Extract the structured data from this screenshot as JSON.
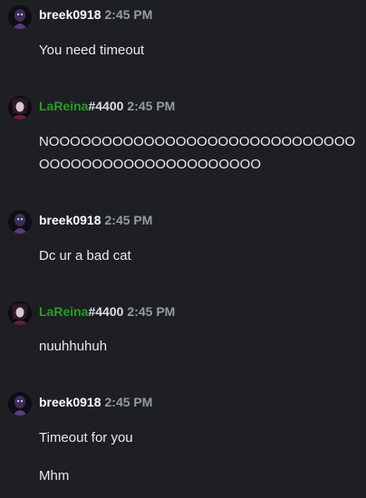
{
  "messages": [
    {
      "user": "breek0918",
      "discriminator": "",
      "user_color": "#ffffff",
      "timestamp": "2:45 PM",
      "lines": [
        "You need timeout"
      ]
    },
    {
      "user": "LaReina",
      "discriminator": "#4400",
      "user_color": "#2c9a2a",
      "timestamp": "2:45 PM",
      "lines": [
        "NOOOOOOOOOOOOOOOOOOOOOOOOOOOOOOOOOOOOOOOOOOOOOOOOOO"
      ]
    },
    {
      "user": "breek0918",
      "discriminator": "",
      "user_color": "#ffffff",
      "timestamp": "2:45 PM",
      "lines": [
        "Dc ur a bad cat"
      ]
    },
    {
      "user": "LaReina",
      "discriminator": "#4400",
      "user_color": "#2c9a2a",
      "timestamp": "2:45 PM",
      "lines": [
        "nuuhhuhuh"
      ]
    },
    {
      "user": "breek0918",
      "discriminator": "",
      "user_color": "#ffffff",
      "timestamp": "2:45 PM",
      "lines": [
        "Timeout for you",
        "Mhm"
      ]
    }
  ],
  "colors": {
    "background": "#1e1f22",
    "timestamp": "#949ba4",
    "text": "#e8e9eb"
  },
  "icons": {
    "avatar_breek": "avatar-dark-character-icon",
    "avatar_lareina": "avatar-dark-character-icon"
  }
}
